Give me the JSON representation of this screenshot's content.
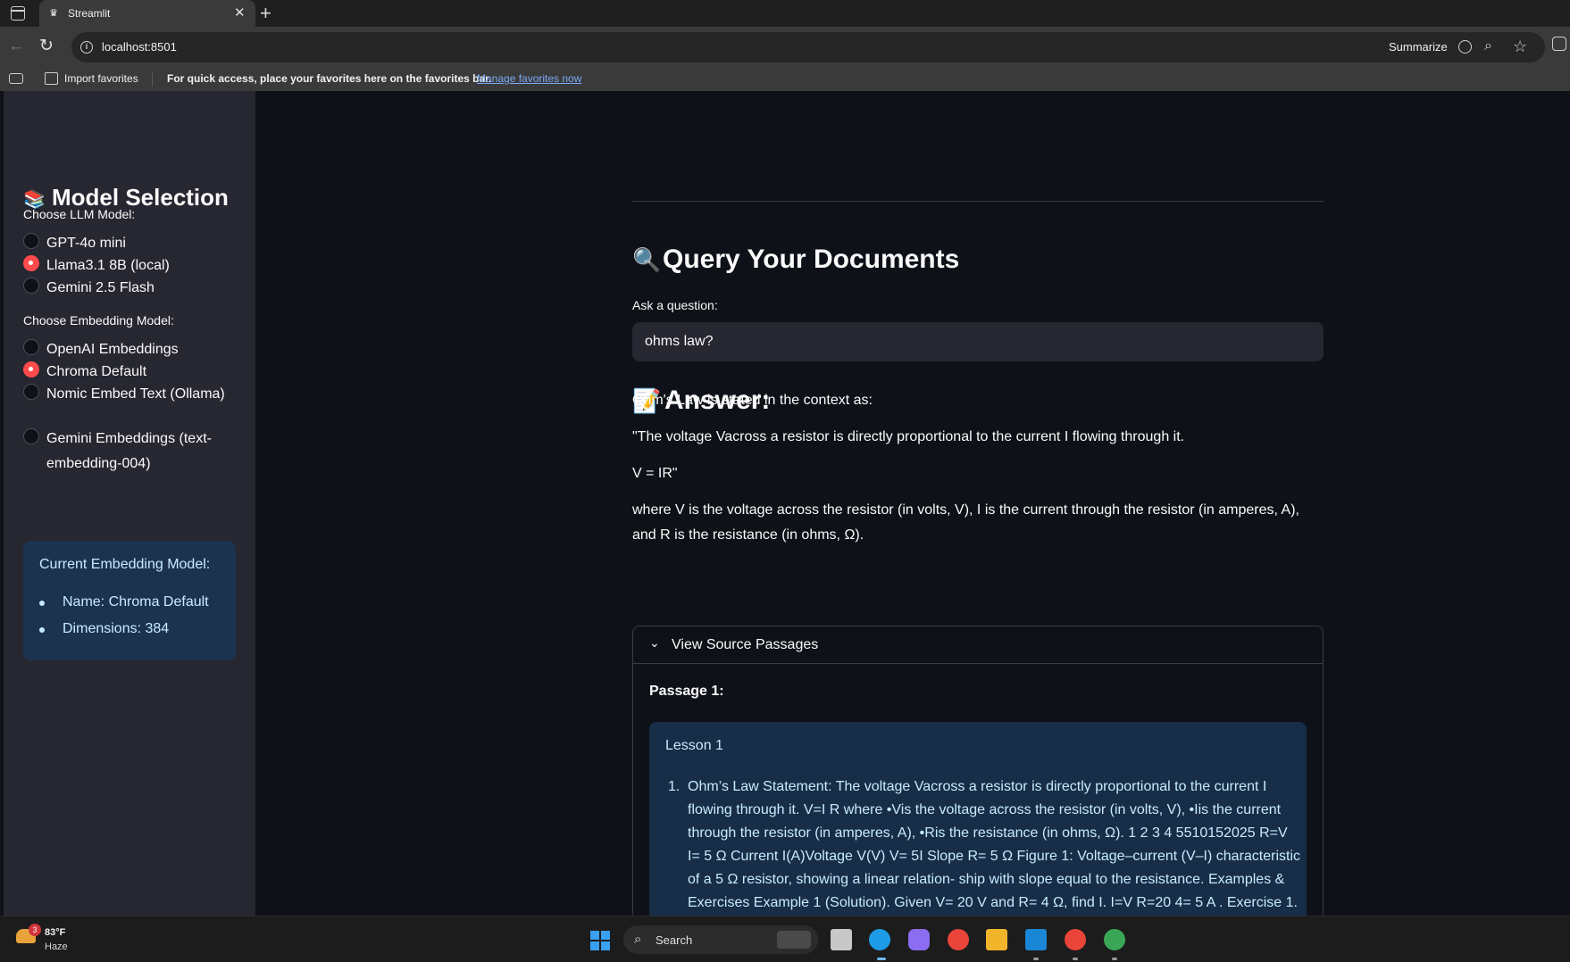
{
  "browser": {
    "tab_title": "Streamlit",
    "url": "localhost:8501",
    "summarize_label": "Summarize",
    "favbar": {
      "import_label": "Import favorites",
      "message": "For quick access, place your favorites here on the favorites bar.",
      "manage_link": "Manage favorites now"
    }
  },
  "sidebar": {
    "title": "Model Selection",
    "llm_label": "Choose LLM Model:",
    "llm_options": [
      {
        "label": "GPT-4o mini",
        "selected": false
      },
      {
        "label": "Llama3.1 8B (local)",
        "selected": true
      },
      {
        "label": "Gemini 2.5 Flash",
        "selected": false
      }
    ],
    "embedding_label": "Choose Embedding Model:",
    "embedding_options": [
      {
        "label": "OpenAI Embeddings",
        "selected": false
      },
      {
        "label": "Chroma Default",
        "selected": true
      },
      {
        "label": "Nomic Embed Text (Ollama)",
        "selected": false
      },
      {
        "label": "Gemini Embeddings (text-embedding-004)",
        "selected": false
      }
    ],
    "info_box": {
      "title": "Current Embedding Model:",
      "name": "Name: Chroma Default",
      "dimensions": "Dimensions: 384"
    }
  },
  "main": {
    "query_heading": "Query Your Documents",
    "ask_label": "Ask a question:",
    "query_value": "ohms law?",
    "answer_heading": "Answer:",
    "answer_paragraphs": [
      "Ohm's Law is stated in the context as:",
      "\"The voltage Vacross a resistor is directly proportional to the current I flowing through it.",
      "V = IR\"",
      "where V is the voltage across the resistor (in volts, V), I is the current through the resistor (in amperes, A), and R is the resistance (in ohms, Ω)."
    ],
    "expander": {
      "title": "View Source Passages",
      "passage_label": "Passage 1:",
      "lesson": "Lesson 1",
      "item_number": "1.",
      "item_text": "Ohm’s Law Statement: The voltage Vacross a resistor is directly proportional to the current I flowing through it. V=I R where •Vis the voltage across the resistor (in volts, V), •Iis the current through the resistor (in amperes, A), •Ris the resistance (in ohms, Ω). 1 2 3 4 5510152025 R=V I= 5 Ω Current I(A)Voltage V(V) V= 5I Slope R= 5 Ω Figure 1: Voltage–current (V–I) characteristic of a 5 Ω resistor, showing a linear relation- ship with slope equal to the resistance. Examples & Exercises Example 1 (Solution). Given V= 20 V and R= 4 Ω, find I. I=V R=20 4= 5 A . Exercise 1."
    }
  },
  "taskbar": {
    "weather_badge": "3",
    "weather_temp": "83°F",
    "weather_cond": "Haze",
    "search_label": "Search"
  },
  "colors": {
    "accent": "#ff4b4b",
    "sidebar_bg": "#262730",
    "main_bg": "#0e1117",
    "info_bg": "#1c3350",
    "info_text": "#c7ebff"
  }
}
